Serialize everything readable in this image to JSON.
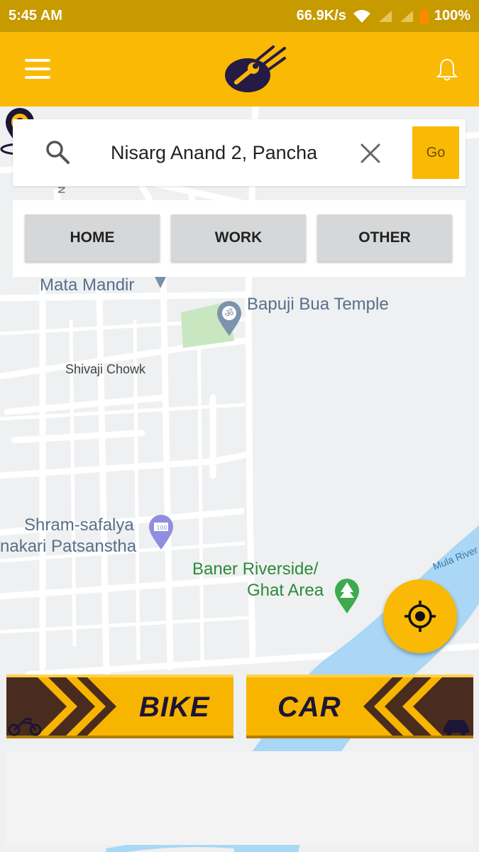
{
  "status_bar": {
    "time": "5:45 AM",
    "speed": "66.9K/s",
    "battery": "100%"
  },
  "search": {
    "value": "Nisarg Anand 2, Pancha",
    "go_label": "Go"
  },
  "quick_places": {
    "home": "HOME",
    "work": "WORK",
    "other": "OTHER"
  },
  "map": {
    "labels": {
      "mata_mandir": "Mata Mandir",
      "bapuji": "Bapuji Bua Temple",
      "shivaji": "Shivaji Chowk",
      "shram1": "Shram-safalya",
      "shram2": "nakari Patsanstha",
      "baner1": "Baner Riverside/",
      "baner2": "Ghat Area",
      "river": "Mula River",
      "road_ni": "Ni"
    }
  },
  "vehicles": {
    "bike": "BIKE",
    "car": "CAR"
  },
  "colors": {
    "brand_yellow": "#f9b905",
    "status_bar": "#c79a00",
    "navy": "#1d1536",
    "river": "#a9d7f5",
    "park": "#c8e6c0"
  }
}
